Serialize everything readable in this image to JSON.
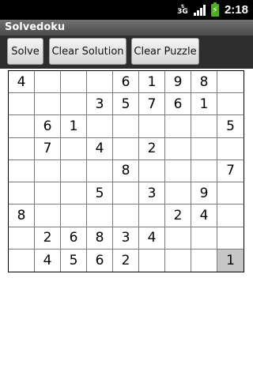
{
  "statusbar": {
    "network": "3G",
    "time": "2:18"
  },
  "app": {
    "title": "Solvedoku"
  },
  "toolbar": {
    "solve_label": "Solve",
    "clear_solution_label": "Clear Solution",
    "clear_puzzle_label": "Clear Puzzle"
  },
  "grid": {
    "rows": [
      [
        "4",
        "",
        "",
        "",
        "6",
        "1",
        "9",
        "8",
        ""
      ],
      [
        "",
        "",
        "",
        "3",
        "5",
        "7",
        "6",
        "1",
        ""
      ],
      [
        "",
        "6",
        "1",
        "",
        "",
        "",
        "",
        "",
        "5"
      ],
      [
        "",
        "7",
        "",
        "4",
        "",
        "2",
        "",
        "",
        ""
      ],
      [
        "",
        "",
        "",
        "",
        "8",
        "",
        "",
        "",
        "7"
      ],
      [
        "",
        "",
        "",
        "5",
        "",
        "3",
        "",
        "9",
        ""
      ],
      [
        "8",
        "",
        "",
        "",
        "",
        "",
        "2",
        "4",
        ""
      ],
      [
        "",
        "2",
        "6",
        "8",
        "3",
        "4",
        "",
        "",
        ""
      ],
      [
        "",
        "4",
        "5",
        "6",
        "2",
        "",
        "",
        "",
        "1"
      ]
    ],
    "selected_cell": {
      "row": 9,
      "col": 9
    },
    "selected_color": "#c6c6c6"
  }
}
